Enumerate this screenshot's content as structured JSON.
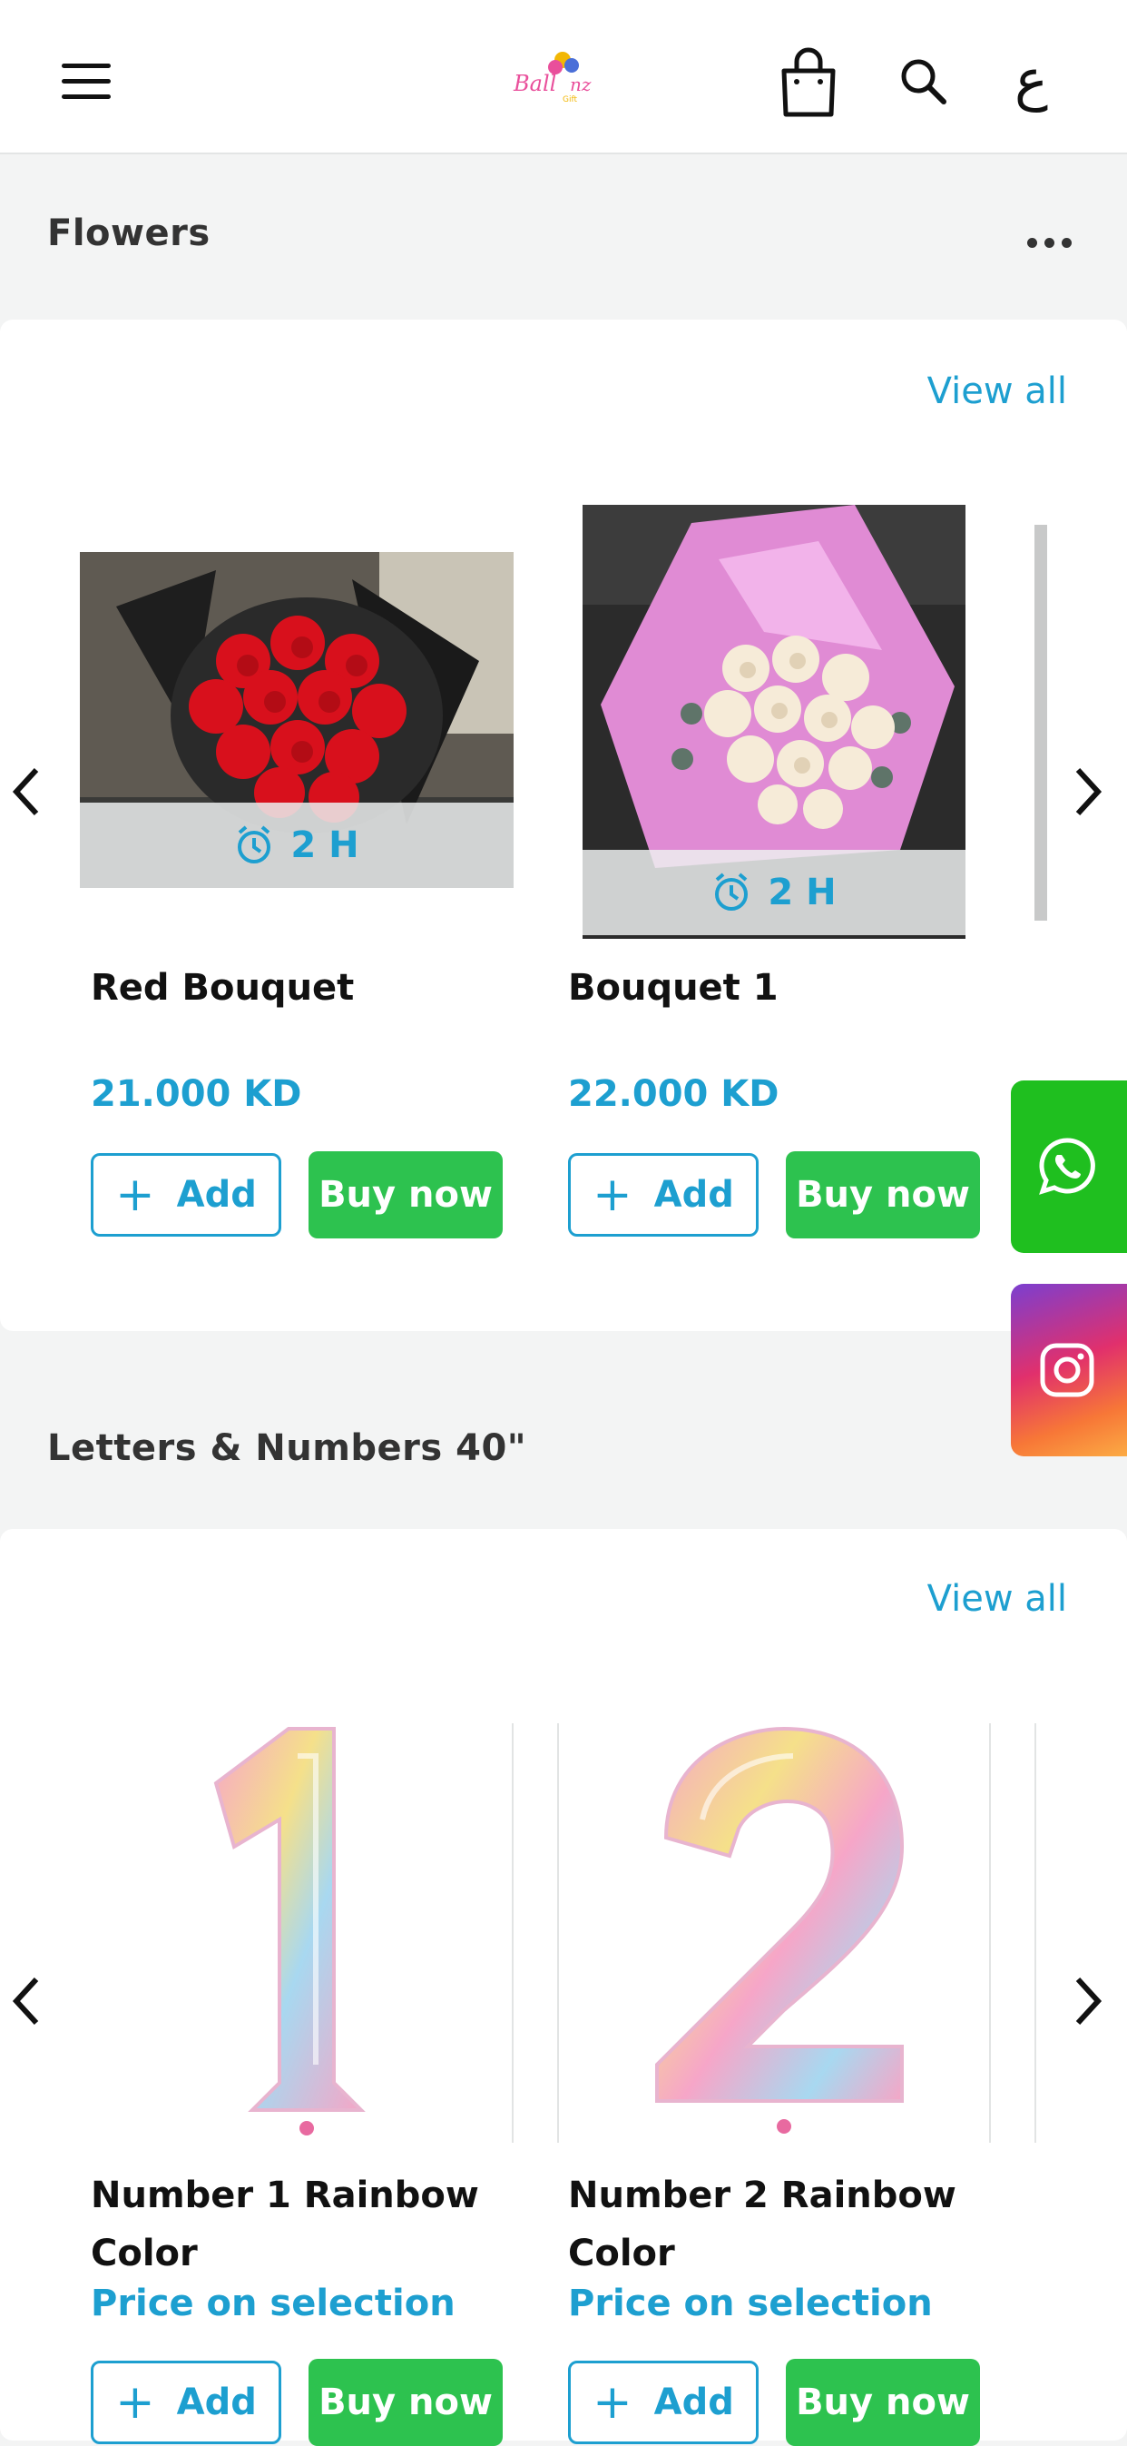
{
  "header": {
    "logo_text": "Ballonz",
    "logo_subtext": "Gift Shop",
    "language_toggle": "ع",
    "icons": [
      "menu-icon",
      "shopping-bag-icon",
      "search-icon"
    ]
  },
  "sections": [
    {
      "title": "Flowers",
      "view_all": "View all",
      "products": [
        {
          "name": "Red Bouquet",
          "price": "21.000 KD",
          "delivery": "2 H",
          "add_label": "Add",
          "buy_label": "Buy now"
        },
        {
          "name": "Bouquet 1",
          "price": "22.000 KD",
          "delivery": "2 H",
          "add_label": "Add",
          "buy_label": "Buy now"
        }
      ]
    },
    {
      "title": "Letters & Numbers 40\"",
      "view_all": "View all",
      "products": [
        {
          "name": "Number 1 Rainbow Color",
          "price": "Price on selection",
          "digit": "1",
          "add_label": "Add",
          "buy_label": "Buy now"
        },
        {
          "name": "Number 2 Rainbow Color",
          "price": "Price on selection",
          "digit": "2",
          "add_label": "Add",
          "buy_label": "Buy now"
        }
      ]
    }
  ],
  "floating": [
    "whatsapp-icon",
    "instagram-icon"
  ],
  "colors": {
    "accent": "#1d9fd0",
    "buy_button": "#2dc24f",
    "whatsapp": "#1fbf1f",
    "background": "#f3f4f4"
  }
}
